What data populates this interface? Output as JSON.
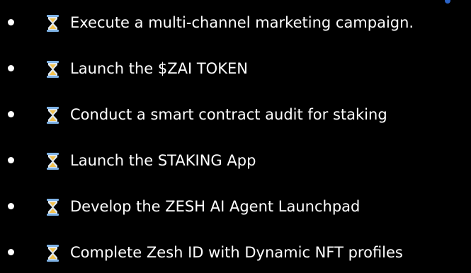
{
  "colors": {
    "background": "#000000",
    "text": "#ffffff",
    "hourglass_frame": "#7fb3e6",
    "hourglass_sand": "#f2c14e",
    "accent": "#2a63c7"
  },
  "icons": {
    "bullet": "bullet-dot",
    "status": "hourglass-icon"
  },
  "tasks": [
    {
      "label": "Execute a multi-channel marketing campaign."
    },
    {
      "label": "Launch the $ZAI TOKEN"
    },
    {
      "label": "Conduct a smart contract audit for staking"
    },
    {
      "label": "Launch the STAKING App"
    },
    {
      "label": "Develop the ZESH AI Agent Launchpad"
    },
    {
      "label": "Complete Zesh ID with Dynamic NFT profiles"
    }
  ]
}
